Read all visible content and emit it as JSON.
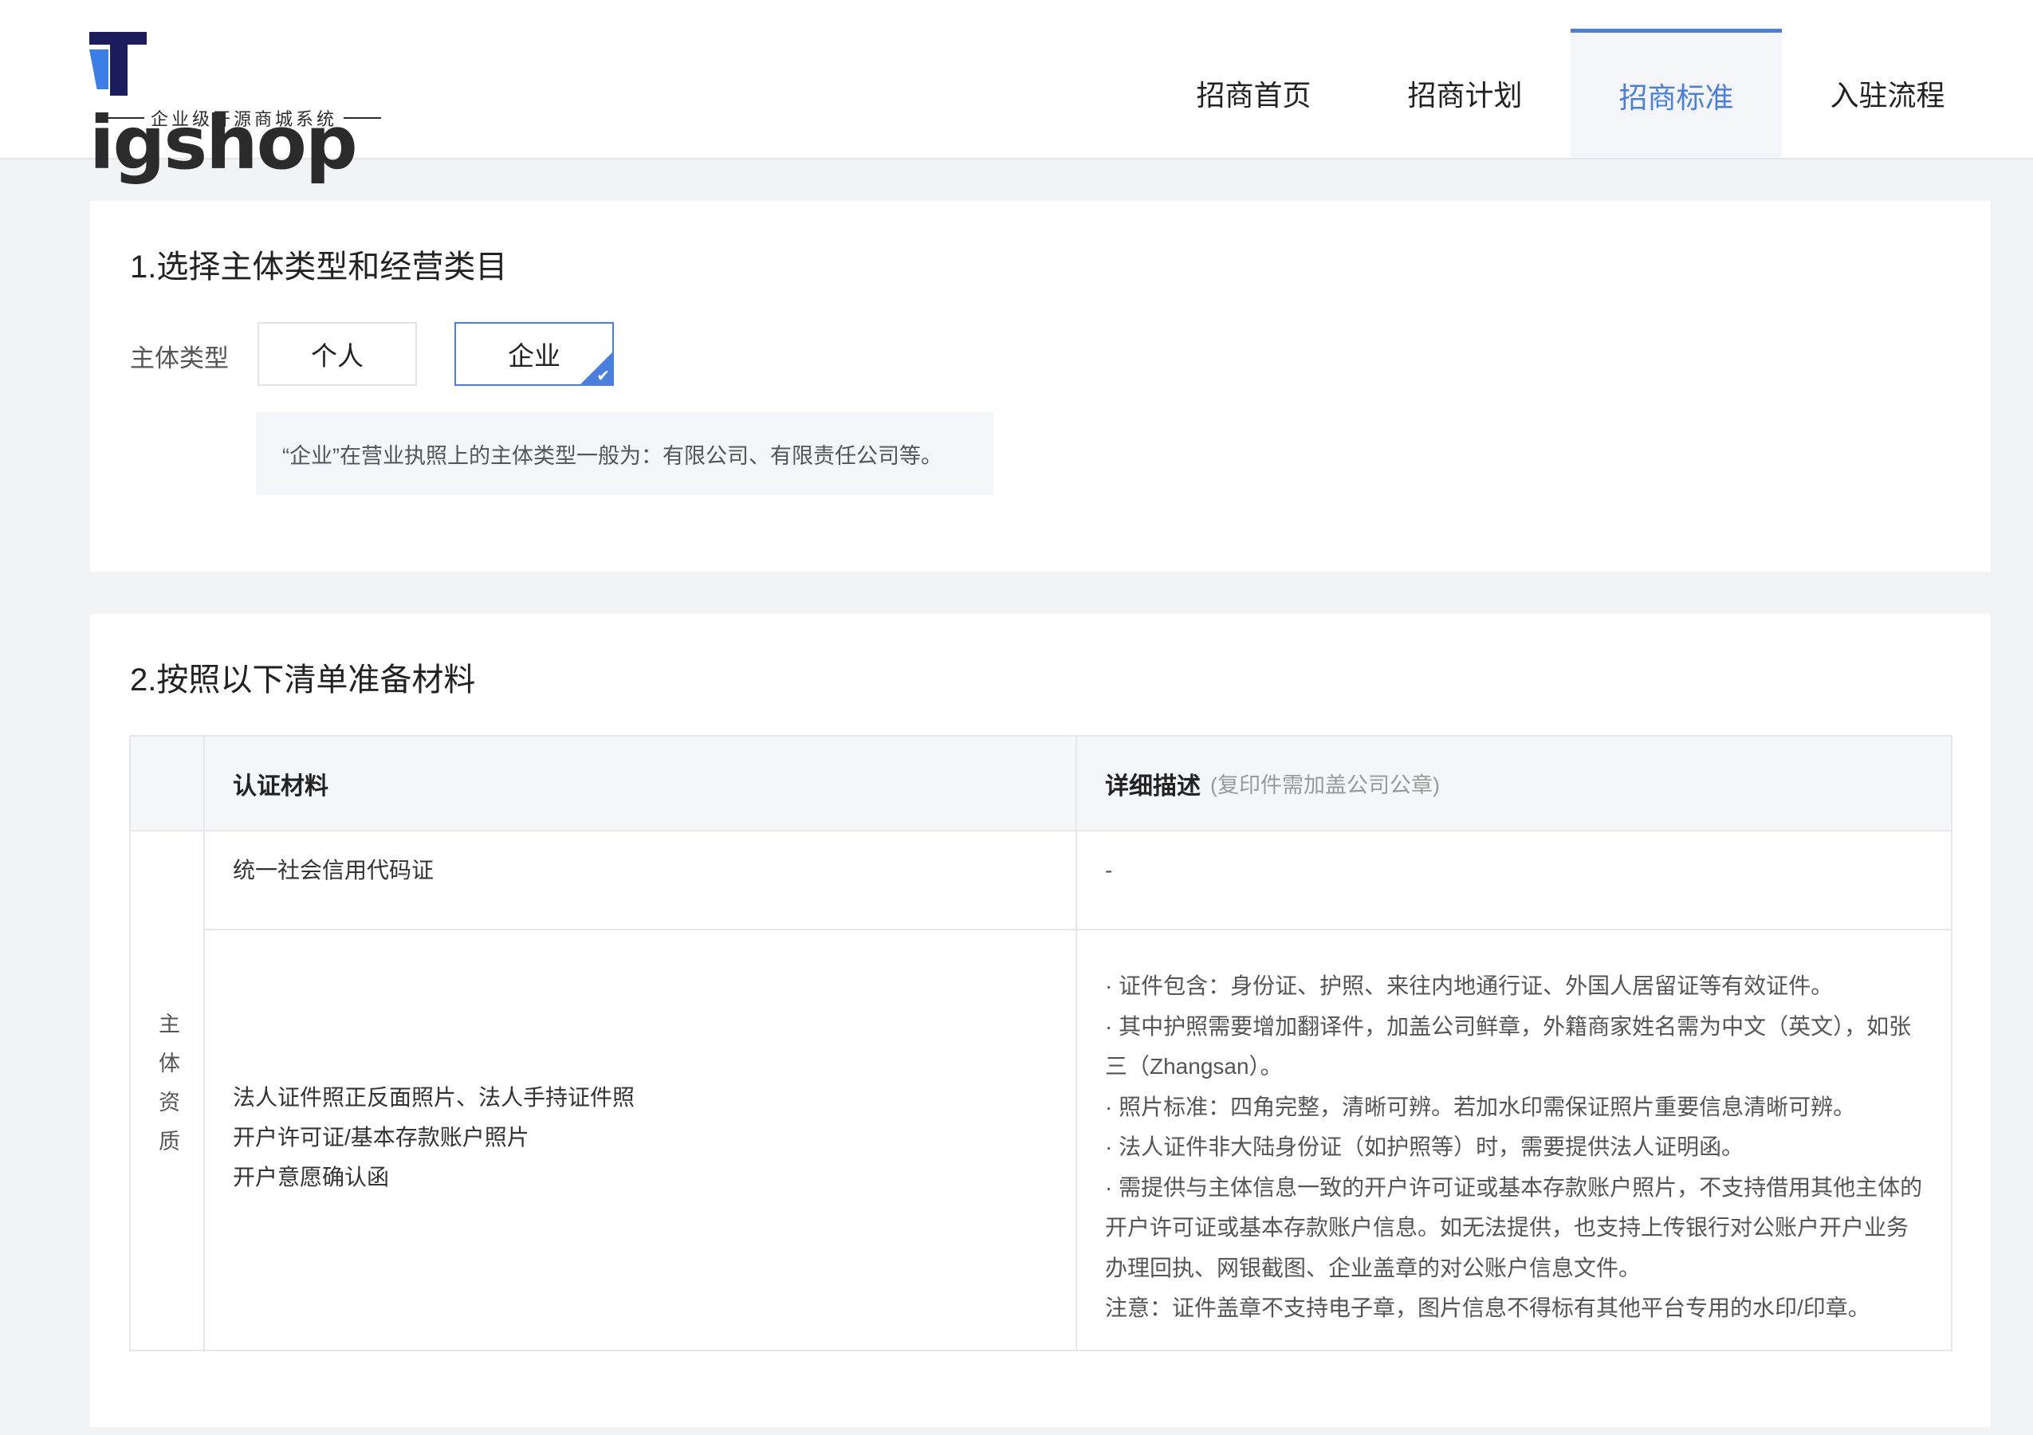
{
  "brand": {
    "name_prefix": "T",
    "name_rest": "igshop",
    "tagline": "企业级开源商城系统",
    "colors": {
      "dark": "#1c1d5c",
      "accent": "#3a7ee8"
    }
  },
  "nav": [
    {
      "label": "招商首页",
      "active": false
    },
    {
      "label": "招商计划",
      "active": false
    },
    {
      "label": "招商标准",
      "active": true
    },
    {
      "label": "入驻流程",
      "active": false
    }
  ],
  "section1": {
    "title": "1.选择主体类型和经营类目",
    "type_label": "主体类型",
    "options": [
      "个人",
      "企业"
    ],
    "selected": "企业",
    "hint": "“企业”在营业执照上的主体类型一般为：有限公司、有限责任公司等。"
  },
  "section2": {
    "title": "2.按照以下清单准备材料",
    "table": {
      "col_material": "认证材料",
      "col_detail": "详细描述",
      "col_detail_note": "(复印件需加盖公司公章)",
      "category": "主体资质",
      "rows": [
        {
          "materials": [
            "统一社会信用代码证"
          ],
          "details": [
            "-"
          ]
        },
        {
          "materials": [
            "法人证件照正反面照片、法人手持证件照",
            "开户许可证/基本存款账户照片",
            "开户意愿确认函"
          ],
          "details": [
            "· 证件包含：身份证、护照、来往内地通行证、外国人居留证等有效证件。",
            "· 其中护照需要增加翻译件，加盖公司鲜章，外籍商家姓名需为中文（英文），如张",
            "三（Zhangsan）。",
            "· 照片标准：四角完整，清晰可辨。若加水印需保证照片重要信息清晰可辨。",
            "· 法人证件非大陆身份证（如护照等）时，需要提供法人证明函。",
            "· 需提供与主体信息一致的开户许可证或基本存款账户照片，不支持借用其他主体的",
            "开户许可证或基本存款账户信息。如无法提供，也支持上传银行对公账户开户业务",
            "办理回执、网银截图、企业盖章的对公账户信息文件。",
            "注意：证件盖章不支持电子章，图片信息不得标有其他平台专用的水印/印章。"
          ]
        }
      ]
    }
  }
}
